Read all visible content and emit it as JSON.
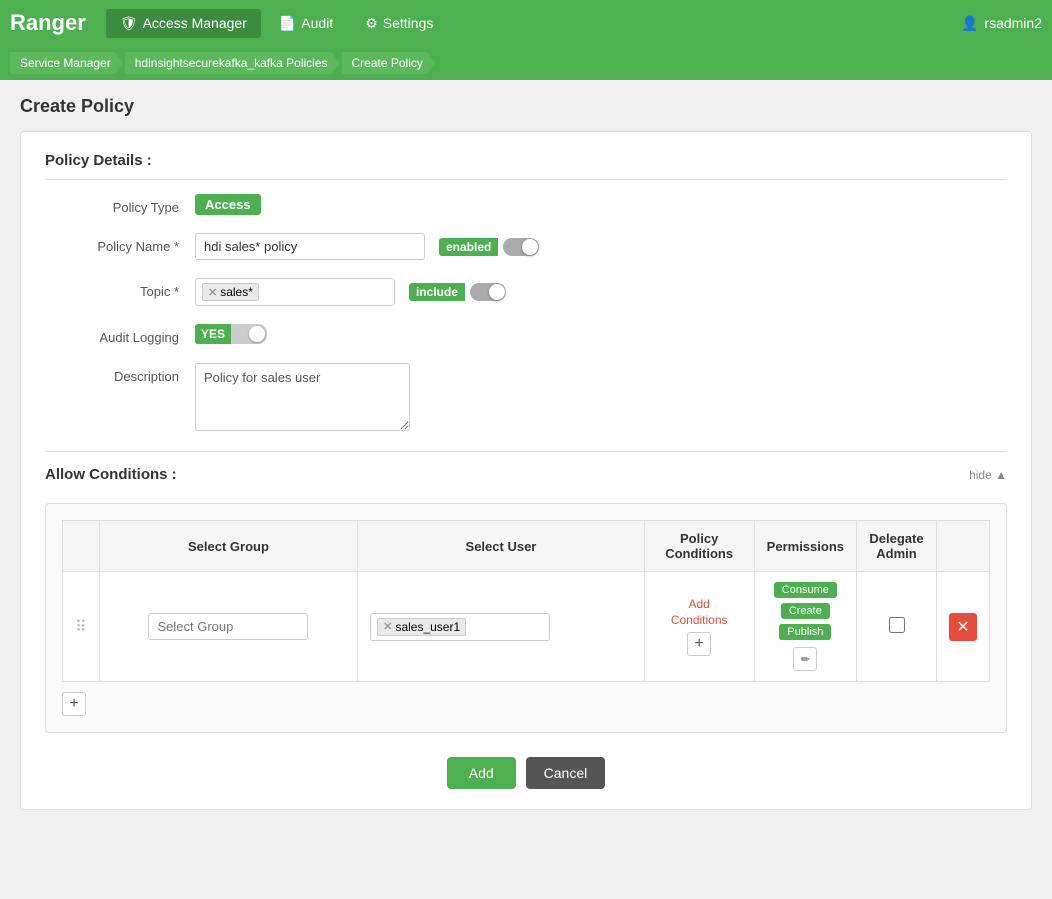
{
  "nav": {
    "brand": "Ranger",
    "items": [
      {
        "id": "access-manager",
        "label": "Access Manager",
        "icon": "🛡",
        "active": true
      },
      {
        "id": "audit",
        "label": "Audit",
        "icon": "📄",
        "active": false
      },
      {
        "id": "settings",
        "label": "Settings",
        "icon": "⚙",
        "active": false
      }
    ],
    "user": "rsadmin2",
    "user_icon": "👤"
  },
  "breadcrumb": {
    "items": [
      {
        "label": "Service Manager"
      },
      {
        "label": "hdinsightsecurekafka_kafka Policies"
      },
      {
        "label": "Create Policy"
      }
    ]
  },
  "page_title": "Create Policy",
  "policy_details": {
    "section_label": "Policy Details :",
    "policy_type_label": "Policy Type",
    "policy_type_value": "Access",
    "policy_name_label": "Policy Name *",
    "policy_name_value": "hdi sales* policy",
    "policy_enabled_label": "enabled",
    "topic_label": "Topic *",
    "topic_tag": "sales*",
    "include_label": "include",
    "audit_logging_label": "Audit Logging",
    "audit_yes_label": "YES",
    "description_label": "Description",
    "description_value": "Policy for sales user"
  },
  "allow_conditions": {
    "section_label": "Allow Conditions :",
    "hide_label": "hide ▲",
    "table": {
      "headers": [
        "Select Group",
        "Select User",
        "Policy Conditions",
        "Permissions",
        "Delegate Admin",
        ""
      ],
      "rows": [
        {
          "select_group_placeholder": "Select Group",
          "select_user_tag": "sales_user1",
          "add_conditions_text": "Add Conditions",
          "permissions": [
            "Consume",
            "Create",
            "Publish"
          ],
          "delegate_admin": false
        }
      ]
    },
    "add_row_label": "+"
  },
  "buttons": {
    "add": "Add",
    "cancel": "Cancel"
  }
}
